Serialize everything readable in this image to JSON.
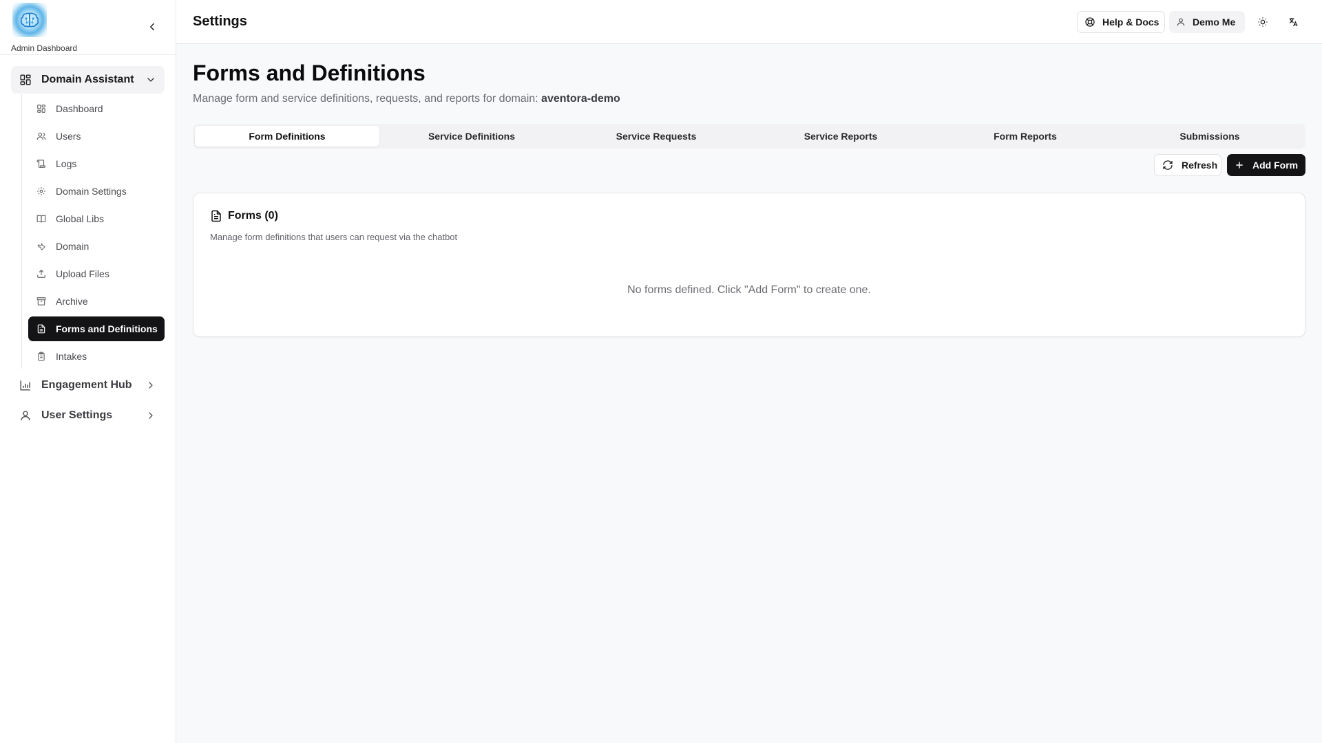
{
  "sidebar": {
    "brand_label": "Admin Dashboard",
    "groups": [
      {
        "label": "Domain Assistant",
        "icon": "layout-grid-icon"
      },
      {
        "label": "Engagement Hub",
        "icon": "bar-chart-icon"
      },
      {
        "label": "User Settings",
        "icon": "user-icon"
      }
    ],
    "items": [
      {
        "label": "Dashboard",
        "icon": "layout-grid-icon"
      },
      {
        "label": "Users",
        "icon": "users-icon"
      },
      {
        "label": "Logs",
        "icon": "scroll-icon"
      },
      {
        "label": "Domain Settings",
        "icon": "gear-icon"
      },
      {
        "label": "Global Libs",
        "icon": "book-icon"
      },
      {
        "label": "Domain",
        "icon": "wrench-icon"
      },
      {
        "label": "Upload Files",
        "icon": "upload-icon"
      },
      {
        "label": "Archive",
        "icon": "archive-icon"
      },
      {
        "label": "Forms and Definitions",
        "icon": "file-text-icon",
        "active": true
      },
      {
        "label": "Intakes",
        "icon": "clipboard-icon"
      }
    ]
  },
  "topbar": {
    "title": "Settings",
    "help_label": "Help & Docs",
    "user_label": "Demo Me"
  },
  "main": {
    "title": "Forms and Definitions",
    "subtitle_prefix": "Manage form and service definitions, requests, and reports for domain:",
    "domain": "aventora-demo",
    "tabs": [
      {
        "label": "Form Definitions",
        "active": true
      },
      {
        "label": "Service Definitions"
      },
      {
        "label": "Service Requests"
      },
      {
        "label": "Service Reports"
      },
      {
        "label": "Form Reports"
      },
      {
        "label": "Submissions"
      }
    ],
    "refresh_label": "Refresh",
    "add_label": "Add Form",
    "card": {
      "title": "Forms (0)",
      "description": "Manage form definitions that users can request via the chatbot",
      "empty_text": "No forms defined. Click \"Add Form\" to create one."
    }
  },
  "colors": {
    "active_bg": "#141416",
    "page_bg": "#f8f9fb",
    "border": "#e4e4e7"
  }
}
